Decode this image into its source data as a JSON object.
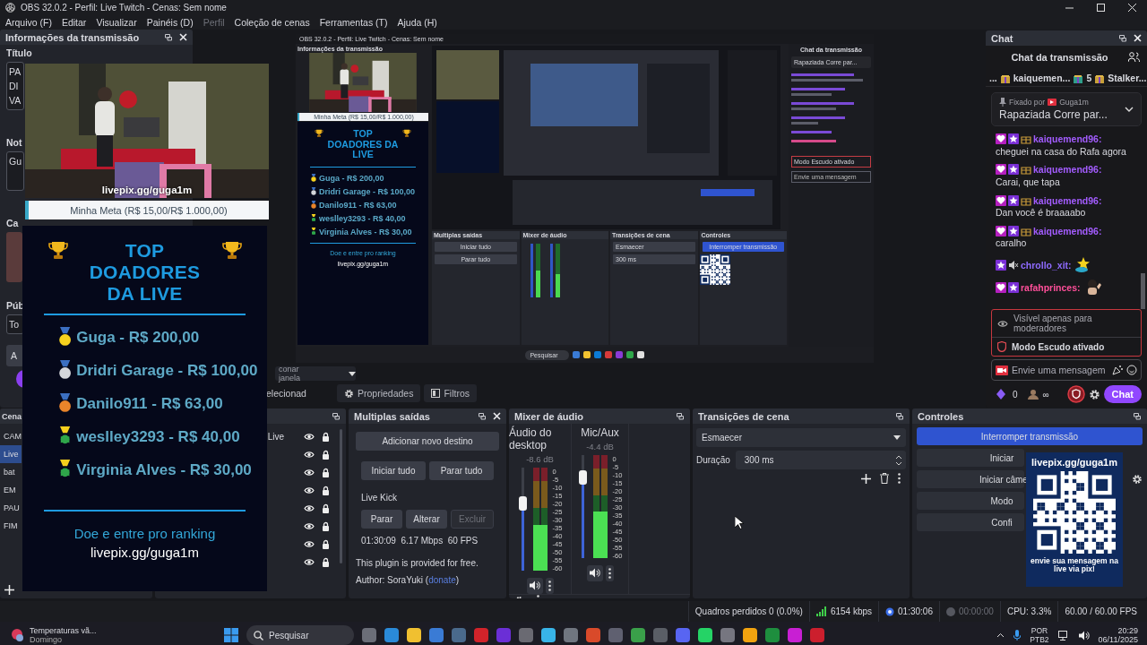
{
  "window": {
    "title": "OBS 32.0.2 - Perfil: Live Twitch - Cenas: Sem nome"
  },
  "menu": [
    {
      "label": "Arquivo (F)",
      "disabled": false
    },
    {
      "label": "Editar",
      "disabled": false
    },
    {
      "label": "Visualizar",
      "disabled": false
    },
    {
      "label": "Painéis (D)",
      "disabled": false
    },
    {
      "label": "Perfil",
      "disabled": true
    },
    {
      "label": "Coleção de cenas",
      "disabled": false
    },
    {
      "label": "Ferramentas (T)",
      "disabled": false
    },
    {
      "label": "Ajuda (H)",
      "disabled": false
    }
  ],
  "stream_info": {
    "title": "Informações da transmissão",
    "title_label": "Título",
    "title_lines": [
      "PA",
      "DI",
      "VA"
    ],
    "notes_label": "Not",
    "notes_value": "Gu",
    "category_label": "Ca",
    "audience_label": "Púb",
    "audience_value": "To",
    "button": "A"
  },
  "preview": {
    "title": "OBS 32.0.2 - Perfil: Live Twitch - Cenas: Sem nome",
    "info_title": "Informações da transmissão",
    "goal": "Minha Meta (R$ 15,00/R$ 1.000,00)",
    "donors_heading": "TOP DOADORES DA LIVE",
    "donors": [
      {
        "text": "Guga - R$ 200,00",
        "kind": "gold"
      },
      {
        "text": "Dridri Garage - R$ 100,00",
        "kind": "silver"
      },
      {
        "text": "Danilo911 - R$ 63,00",
        "kind": "bronze"
      },
      {
        "text": "weslley3293 - R$ 40,00",
        "kind": "green"
      },
      {
        "text": "Virginia Alves - R$ 30,00",
        "kind": "green"
      }
    ],
    "footer": "Doe e entre pro ranking",
    "link": "livepix.gg/guga1m",
    "docks": [
      {
        "title": "Multiplas saídas",
        "kind": "outputs",
        "buttons": [
          "Iniciar tudo",
          "Parar tudo"
        ]
      },
      {
        "title": "Mixer de áudio",
        "kind": "mixer"
      },
      {
        "title": "Transições de cena",
        "kind": "transitions",
        "value": "Esmaecer",
        "duration": "300 ms"
      },
      {
        "title": "Controles",
        "kind": "controls",
        "value": "Interromper transmissão"
      }
    ],
    "chat_title": "Chat da transmissão",
    "pinned": "Rapaziada Corre par...",
    "shield": "Modo Escudo ativado",
    "input": "Envie uma mensagem",
    "search": "Pesquisar"
  },
  "source_bar": {
    "window_hint": "conar janela",
    "selection": "elecionad",
    "buttons": [
      {
        "label": "Propriedades",
        "kind": "properties"
      },
      {
        "label": "Filtros",
        "kind": "filters"
      }
    ]
  },
  "chat": {
    "dock_title": "Chat",
    "title": "Chat da transmissão",
    "gift_lead": "...",
    "gifters": [
      "kaiquemen...",
      "5",
      "Stalker..."
    ],
    "pinned": {
      "label": "Fixado por",
      "by": "Guga1m",
      "text": "Rapaziada Corre par..."
    },
    "messages": [
      {
        "kind": "text",
        "user": "kaiquemend96:",
        "color": "#a35cff",
        "text": "cheguei na casa do Rafa agora",
        "badges": [
          {
            "kind": "sub"
          },
          {
            "kind": "star"
          },
          {
            "kind": "gift"
          }
        ]
      },
      {
        "kind": "text",
        "user": "kaiquemend96:",
        "color": "#a35cff",
        "text": "Carai, que tapa",
        "badges": [
          {
            "kind": "sub"
          },
          {
            "kind": "star"
          },
          {
            "kind": "gift"
          }
        ]
      },
      {
        "kind": "text",
        "user": "kaiquemend96:",
        "color": "#a35cff",
        "text": "Dan você é braaaabo",
        "badges": [
          {
            "kind": "sub"
          },
          {
            "kind": "star"
          },
          {
            "kind": "gift"
          }
        ]
      },
      {
        "kind": "text",
        "user": "kaiquemend96:",
        "color": "#a35cff",
        "text": "caralho",
        "badges": [
          {
            "kind": "sub"
          },
          {
            "kind": "star"
          },
          {
            "kind": "gift"
          }
        ]
      },
      {
        "kind": "emote",
        "user": "chrollo_xit:",
        "color": "#8f6bff",
        "badges": [
          {
            "kind": "star"
          },
          {
            "kind": "mute"
          }
        ]
      },
      {
        "kind": "emote",
        "user": "rafahprinces:",
        "color": "#ff4f9a",
        "badges": [
          {
            "kind": "sub"
          },
          {
            "kind": "star"
          }
        ]
      }
    ],
    "notice": "Visível apenas para moderadores",
    "shield": "Modo Escudo ativado",
    "input_placeholder": "Envie uma mensagem",
    "points": "0",
    "viewers": "∞",
    "send": "Chat"
  },
  "scenes": {
    "title": "Cena",
    "items": [
      {
        "name": "CAM",
        "selected": false
      },
      {
        "name": "Live",
        "selected": true
      },
      {
        "name": "bat",
        "selected": false
      },
      {
        "name": "EM",
        "selected": false
      },
      {
        "name": "PAU",
        "selected": false
      },
      {
        "name": "FIM",
        "selected": false
      }
    ]
  },
  "sources": {
    "items": [
      {
        "name": "Live",
        "visible": true,
        "locked": true
      },
      {
        "visible": true,
        "locked": true
      },
      {
        "visible": true,
        "locked": true
      },
      {
        "visible": true,
        "locked": true
      },
      {
        "visible": true,
        "locked": true
      },
      {
        "visible": true,
        "locked": true
      },
      {
        "visible": true,
        "locked": true
      },
      {
        "visible": true,
        "locked": true
      }
    ]
  },
  "outputs": {
    "title": "Multiplas saídas",
    "add": "Adicionar novo destino",
    "start_all": "Iniciar tudo",
    "stop_all": "Parar tudo",
    "target": "Live Kick",
    "target_buttons": [
      {
        "label": "Parar",
        "disabled": false
      },
      {
        "label": "Alterar",
        "disabled": false
      },
      {
        "label": "Excluir",
        "disabled": true
      }
    ],
    "stats": "01:30:09  6.17 Mbps  60 FPS",
    "note": "This plugin is provided for free.",
    "author_prefix": "Author: SoraYuki (",
    "author_link": "donate",
    "author_suffix": ")"
  },
  "mixer": {
    "title": "Mixer de áudio",
    "channels": [
      {
        "name": "Áudio do desktop",
        "reading": "-8.6 dB",
        "level": 0.65,
        "scale": [
          "0",
          "-5",
          "-10",
          "-15",
          "-20",
          "-25",
          "-30",
          "-35",
          "-40",
          "-45",
          "-50",
          "-55",
          "-60"
        ]
      },
      {
        "name": "Mic/Aux",
        "reading": "-4.4 dB",
        "level": 0.78,
        "scale": [
          "0",
          "-5",
          "-10",
          "-15",
          "-20",
          "-25",
          "-30",
          "-35",
          "-40",
          "-45",
          "-50",
          "-55",
          "-60"
        ]
      }
    ]
  },
  "transitions": {
    "title": "Transições de cena",
    "type": "Esmaecer",
    "duration_label": "Duração",
    "duration": "300 ms"
  },
  "controls": {
    "title": "Controles",
    "buttons": [
      {
        "label": "Interromper transmissão",
        "active": true
      },
      {
        "label": "Iniciar",
        "active": false
      },
      {
        "label": "Iniciar câme",
        "active": false
      },
      {
        "label": "Modo",
        "active": false
      },
      {
        "label": "Confi",
        "active": false
      }
    ]
  },
  "status": {
    "dropped": "Quadros perdidos 0 (0.0%)",
    "bitrate": "6154 kbps",
    "stream_time": "01:30:06",
    "streaming": true,
    "record_time": "00:00:00",
    "recording": false,
    "cpu": "CPU: 3.3%",
    "fps": "60.00 / 60.00 FPS"
  },
  "camera_overlay": {
    "caption": "livepix.gg/guga1m",
    "goal": "Minha Meta (R$ 15,00/R$ 1.000,00)"
  },
  "donors_overlay": {
    "heading": "TOP DOADORES DA LIVE",
    "entries": [
      {
        "text": "Guga - R$ 200,00",
        "kind": "gold"
      },
      {
        "text": "Dridri Garage - R$ 100,00",
        "kind": "silver"
      },
      {
        "text": "Danilo911 - R$ 63,00",
        "kind": "bronze"
      },
      {
        "text": "weslley3293 - R$ 40,00",
        "kind": "green"
      },
      {
        "text": "Virginia Alves - R$ 30,00",
        "kind": "green"
      }
    ],
    "footer": "Doe e entre pro ranking",
    "link": "livepix.gg/guga1m"
  },
  "qr_overlay": {
    "caption": "livepix.gg/guga1m",
    "message": "envie sua mensagem na live via pix!"
  },
  "taskbar": {
    "weather": "Temperaturas vã...",
    "day": "Domingo",
    "search": "Pesquisar",
    "language": "POR",
    "layout": "PTB2",
    "time": "20:29",
    "date": "06/11/2025"
  }
}
